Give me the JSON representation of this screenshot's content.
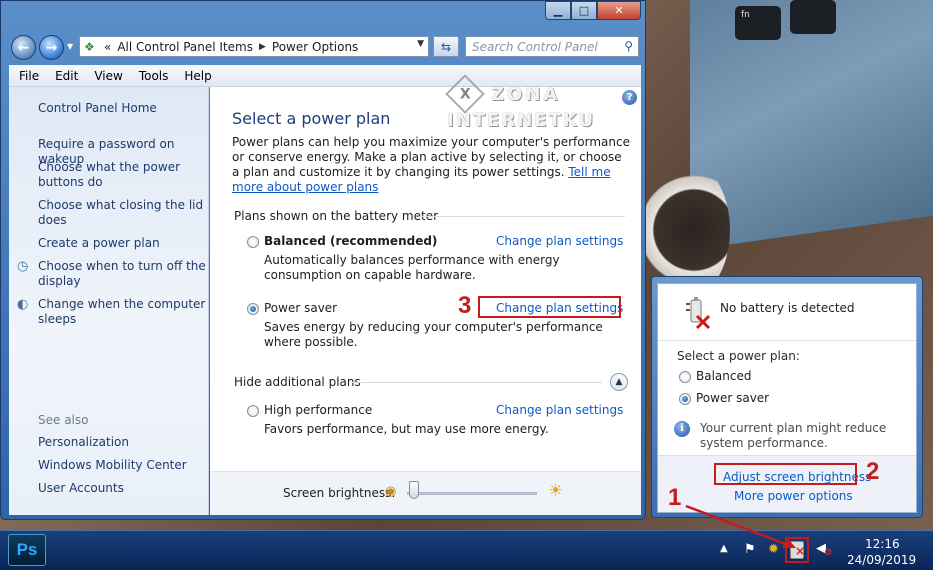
{
  "window": {
    "caption": {
      "minimize": "▁",
      "maximize": "□",
      "close": "✕"
    },
    "address": {
      "prefix": "«",
      "crumbs": [
        "All Control Panel Items",
        "Power Options"
      ]
    },
    "search": {
      "placeholder": "Search Control Panel"
    }
  },
  "menu": [
    "File",
    "Edit",
    "View",
    "Tools",
    "Help"
  ],
  "sidebar": {
    "home": "Control Panel Home",
    "links": [
      "Require a password on wakeup",
      "Choose what the power buttons do",
      "Choose what closing the lid does",
      "Create a power plan",
      "Choose when to turn off the display",
      "Change when the computer sleeps"
    ],
    "see_also_heading": "See also",
    "see_also": [
      "Personalization",
      "Windows Mobility Center",
      "User Accounts"
    ]
  },
  "content": {
    "title": "Select a power plan",
    "description": "Power plans can help you maximize your computer's performance or conserve energy. Make a plan active by selecting it, or choose a plan and customize it by changing its power settings.",
    "tell_me_more": "Tell me more about power plans",
    "battery_meter_heading": "Plans shown on the battery meter",
    "plans": [
      {
        "name": "Balanced (recommended)",
        "desc": "Automatically balances performance with energy consumption on capable hardware.",
        "link": "Change plan settings",
        "selected": false
      },
      {
        "name": "Power saver",
        "desc": "Saves energy by reducing your computer's performance where possible.",
        "link": "Change plan settings",
        "selected": true
      }
    ],
    "hide_heading": "Hide additional plans",
    "extra_plans": [
      {
        "name": "High performance",
        "desc": "Favors performance, but may use more energy.",
        "link": "Change plan settings",
        "selected": false
      }
    ],
    "brightness_label": "Screen brightness:",
    "brightness_level": 0.02
  },
  "watermark": {
    "line1": "ZONA",
    "line2": "INTERNETKU"
  },
  "annotations": [
    "1",
    "2",
    "3"
  ],
  "popup": {
    "status": "No battery is detected",
    "select_label": "Select a power plan:",
    "plans": [
      {
        "name": "Balanced",
        "selected": false
      },
      {
        "name": "Power saver",
        "selected": true
      }
    ],
    "warning": "Your current plan might reduce system performance.",
    "brightness_link": "Adjust screen brightness",
    "more_link": "More power options"
  },
  "taskbar": {
    "app": "Ps",
    "time": "12:16",
    "date": "24/09/2019"
  },
  "colors": {
    "link": "#0d59c7",
    "annotation": "#c21c1c",
    "title": "#1e3e7a"
  }
}
